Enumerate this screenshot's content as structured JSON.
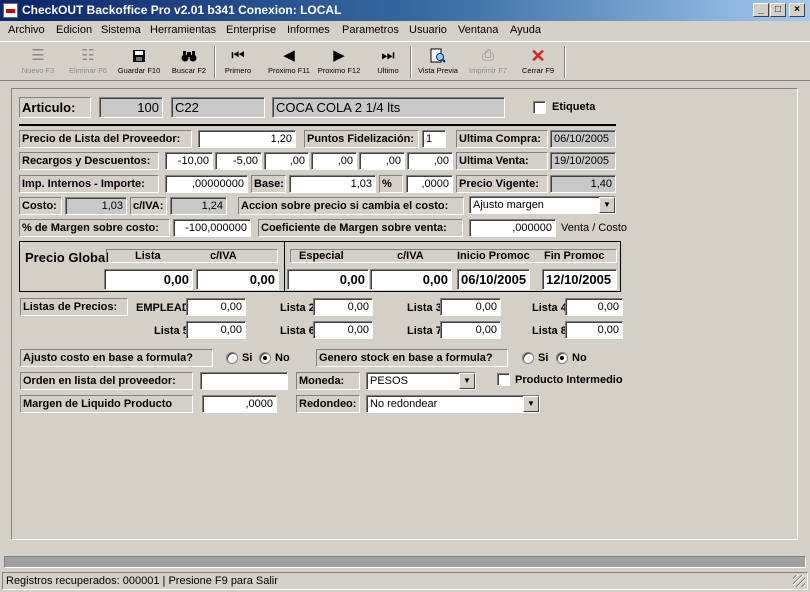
{
  "window": {
    "title": "CheckOUT Backoffice Pro v2.01 b341 Conexion: LOCAL"
  },
  "menu": [
    "Archivo",
    "Edicion",
    "Sistema",
    "Herramientas",
    "Enterprise",
    "Informes",
    "Parametros",
    "Usuario",
    "Ventana",
    "Ayuda"
  ],
  "toolbar": {
    "nuevo": "Nuevo F3",
    "eliminar": "Eliminar F6",
    "guardar": "Guardar F10",
    "buscar": "Buscar F2",
    "primero": "Primero",
    "proximo_f11": "Proximo F11",
    "proximo_f12": "Proximo F12",
    "ultimo": "Ultimo",
    "vista_previa": "Vista Previa",
    "imprimir": "Imprimir F7",
    "cerrar": "Cerrar F9"
  },
  "articulo": {
    "label": "Articulo:",
    "numero": "100",
    "codigo": "C22",
    "descripcion": "COCA COLA 2 1/4 lts",
    "etiqueta_label": "Etiqueta"
  },
  "precios": {
    "precio_lista_label": "Precio de Lista del Proveedor:",
    "precio_lista": "1,20",
    "puntos_label": "Puntos Fidelización:",
    "puntos": "1",
    "ultima_compra_label": "Ultima Compra:",
    "ultima_compra": "06/10/2005",
    "recargos_label": "Recargos y Descuentos:",
    "recargos": [
      "-10,00",
      "-5,00",
      ",00",
      ",00",
      ",00",
      ",00"
    ],
    "ultima_venta_label": "Ultima Venta:",
    "ultima_venta": "19/10/2005",
    "imp_internos_label": "Imp. Internos - Importe:",
    "imp_internos": ",00000000",
    "base_label": "Base:",
    "base": "1,03",
    "pct_label": "%",
    "pct": ",0000",
    "precio_vigente_label": "Precio Vigente:",
    "precio_vigente": "1,40",
    "costo_label": "Costo:",
    "costo": "1,03",
    "civa_label": "c/IVA:",
    "civa": "1,24",
    "accion_label": "Accion sobre precio si cambia el costo:",
    "accion": "Ajusto margen",
    "margen_costo_label": "% de Margen sobre costo:",
    "margen_costo": "-100,000000",
    "coef_label": "Coeficiente de Margen sobre venta:",
    "coef": ",000000",
    "venta_costo": "Venta / Costo"
  },
  "precio_global": {
    "label": "Precio Global",
    "lista_hdr": "Lista",
    "civa_hdr": "c/IVA",
    "lista": "0,00",
    "civa": "0,00",
    "especial_hdr": "Especial",
    "civa2_hdr": "c/IVA",
    "inicio_hdr": "Inicio Promoc",
    "fin_hdr": "Fin Promoc",
    "especial": "0,00",
    "civa2": "0,00",
    "inicio": "06/10/2005",
    "fin": "12/10/2005"
  },
  "listas": {
    "label": "Listas de Precios:",
    "items": [
      {
        "name": "EMPLEAD",
        "value": "0,00"
      },
      {
        "name": "Lista 2",
        "value": "0,00"
      },
      {
        "name": "Lista 3",
        "value": "0,00"
      },
      {
        "name": "Lista 4",
        "value": "0,00"
      },
      {
        "name": "Lista 5",
        "value": "0,00"
      },
      {
        "name": "Lista 6",
        "value": "0,00"
      },
      {
        "name": "Lista 7",
        "value": "0,00"
      },
      {
        "name": "Lista 8",
        "value": "0,00"
      }
    ]
  },
  "opciones": {
    "ajusto_label": "Ajusto costo en base a formula?",
    "genero_label": "Genero stock en base a formula?",
    "si": "Si",
    "no": "No",
    "orden_label": "Orden en lista del proveedor:",
    "orden": "",
    "moneda_label": "Moneda:",
    "moneda": "PESOS",
    "producto_intermedio": "Producto Intermedio",
    "margen_liquido_label": "Margen de Liquido Producto",
    "margen_liquido": ",0000",
    "redondeo_label": "Redondeo:",
    "redondeo": "No redondear"
  },
  "status": {
    "text": "Registros recuperados: 000001 | Presione F9 para Salir"
  },
  "colors": {
    "titlebar": "#0a246a",
    "face": "#d4d0c8",
    "cerrar_icon": "#e02020"
  }
}
